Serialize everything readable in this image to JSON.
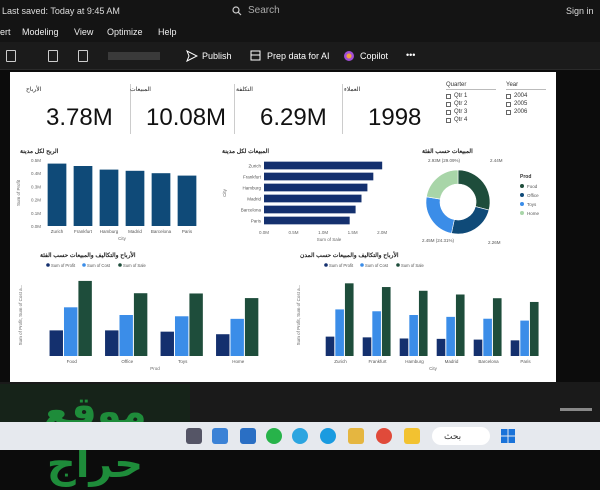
{
  "titlebar": {
    "saved": "Last saved: Today at 9:45 AM",
    "search": "Search",
    "signin": "Sign in"
  },
  "menu": [
    "ert",
    "Modeling",
    "View",
    "Optimize",
    "Help"
  ],
  "ribbon": {
    "publish": "Publish",
    "prep": "Prep data for AI",
    "copilot": "Copilot",
    "more": "•••"
  },
  "kpis": [
    {
      "label": "الأرباح",
      "value": "3.78M"
    },
    {
      "label": "المبيعات",
      "value": "10.08M"
    },
    {
      "label": "التكلفة",
      "value": "6.29M"
    },
    {
      "label": "العملاء",
      "value": "1998"
    }
  ],
  "slicers": {
    "quarter": {
      "title": "Quarter",
      "items": [
        "Qtr 1",
        "Qtr 2",
        "Qtr 3",
        "Qtr 4"
      ]
    },
    "year": {
      "title": "Year",
      "items": [
        "2004",
        "2005",
        "2006"
      ]
    }
  },
  "colors": {
    "dark": "#0f4a78",
    "navy": "#14306e",
    "blue": "#3b8de8",
    "green": "#1e4d3b",
    "brand_watermark": "#1e8c3a"
  },
  "chart_data": [
    {
      "type": "bar",
      "title": "الربح لكل مدينة",
      "categories": [
        "Zurich",
        "Frankfurt",
        "Hamburg",
        "Madrid",
        "Barcelona",
        "Paris"
      ],
      "tick_labels": [
        "Zurich",
        "Frankfurt",
        "Hamburg",
        "Madrid",
        "Barcelona",
        "Paris"
      ],
      "xlabel": "City",
      "ylabel": "Sum of Profit",
      "yticks": [
        "0.0M",
        "0.1M",
        "0.2M",
        "0.3M",
        "0.4M",
        "0.5M"
      ],
      "values": [
        0.52,
        0.5,
        0.47,
        0.46,
        0.44,
        0.42
      ],
      "ylim": [
        0,
        0.55
      ]
    },
    {
      "type": "bar",
      "orientation": "horizontal",
      "title": "المبيعات لكل مدينة",
      "categories": [
        "Zurich",
        "Frankfurt",
        "Hamburg",
        "Madrid",
        "Barcelona",
        "Paris"
      ],
      "values": [
        2.0,
        1.85,
        1.75,
        1.65,
        1.55,
        1.45
      ],
      "xticks": [
        "0.0M",
        "0.5M",
        "1.0M",
        "1.5M",
        "2.0M"
      ],
      "xlabel": "Sum of Sale",
      "ylabel": "City",
      "xlim": [
        0,
        2.2
      ]
    },
    {
      "type": "pie",
      "title": "المبيعات حسب الفئة",
      "legend_title": "Prod",
      "labels": [
        "Food",
        "Office",
        "Toys",
        "Home"
      ],
      "values": [
        2.93,
        2.44,
        2.45,
        2.26
      ],
      "data_labels": [
        "2.93M (29.09%)",
        "2.44M",
        "2.45M (24.31%)",
        "2.26M"
      ],
      "colors": [
        "#1e4d3b",
        "#0f4a78",
        "#3b8de8",
        "#a8d5a8"
      ],
      "legend": "right",
      "hole": true
    },
    {
      "type": "bar",
      "title": "الأرباح والتكاليف والمبيعات حسب الفئة",
      "legend": "top-left",
      "legend_labels": [
        "Sum of Profit",
        "Sum of Cost",
        "Sum of Sale"
      ],
      "categories": [
        "Food",
        "Office",
        "Toys",
        "Home"
      ],
      "series": [
        {
          "name": "Sum of Profit",
          "values": [
            1.0,
            1.0,
            0.95,
            0.85
          ]
        },
        {
          "name": "Sum of Cost",
          "values": [
            1.9,
            1.6,
            1.55,
            1.45
          ]
        },
        {
          "name": "Sum of Sale",
          "values": [
            2.93,
            2.45,
            2.44,
            2.26
          ]
        }
      ],
      "xlabel": "Prod",
      "ylabel": "Sum of Profit, Sum of Cost a...",
      "ylim": [
        0,
        3.2
      ]
    },
    {
      "type": "bar",
      "title": "الأرباح والتكاليف والمبيعات حسب المدن",
      "legend": "top-left",
      "legend_labels": [
        "Sum of Profit",
        "Sum of Cost",
        "Sum of Sale"
      ],
      "categories": [
        "Zurich",
        "Frankfurt",
        "Hamburg",
        "Madrid",
        "Barcelona",
        "Paris"
      ],
      "series": [
        {
          "name": "Sum of Profit",
          "values": [
            0.52,
            0.5,
            0.47,
            0.46,
            0.44,
            0.42
          ]
        },
        {
          "name": "Sum of Cost",
          "values": [
            1.25,
            1.2,
            1.1,
            1.05,
            1.0,
            0.95
          ]
        },
        {
          "name": "Sum of Sale",
          "values": [
            1.95,
            1.85,
            1.75,
            1.65,
            1.55,
            1.45
          ]
        }
      ],
      "xlabel": "City",
      "ylabel": "Sum of Profit, Sum of Cost a...",
      "ylim": [
        0,
        2.2
      ]
    }
  ],
  "watermark": "موقع حراج",
  "taskbar": {
    "search": "بحث"
  }
}
